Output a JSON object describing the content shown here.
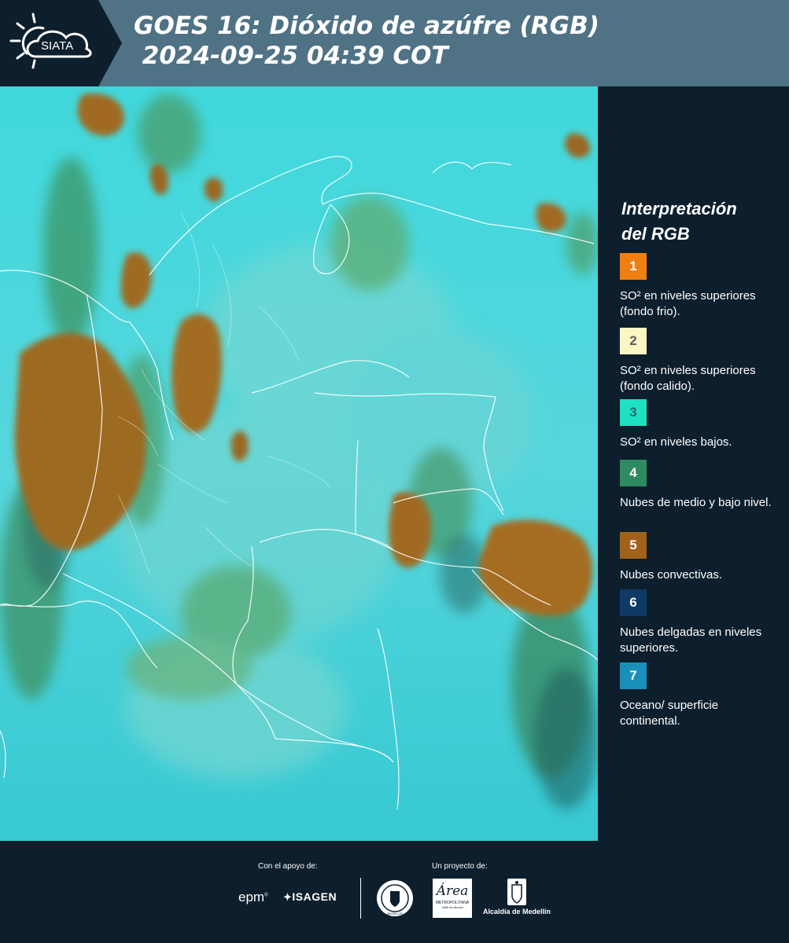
{
  "header": {
    "logo_text": "SIATA",
    "title_line1": "GOES 16: Dióxido de azúfre (RGB)",
    "title_line2": " 2024-09-25 04:39 COT"
  },
  "legend": {
    "title_line1": "Interpretación",
    "title_line2": "del RGB",
    "items": [
      {
        "number": "1",
        "label": "SO² en niveles superiores (fondo frio).",
        "color": "#f07f12",
        "text_color": "#ffffff"
      },
      {
        "number": "2",
        "label": "SO² en niveles superiores (fondo calido).",
        "color": "#fdf5c4",
        "text_color": "#5a5a5a"
      },
      {
        "number": "3",
        "label": "SO² en niveles bajos.",
        "color": "#1fe0c0",
        "text_color": "#2f6a6a"
      },
      {
        "number": "4",
        "label": "Nubes de medio y bajo nivel.",
        "color": "#2f8a5f",
        "text_color": "#ffffff"
      },
      {
        "number": "5",
        "label": "Nubes convectivas.",
        "color": "#a0621a",
        "text_color": "#ffffff"
      },
      {
        "number": "6",
        "label": "Nubes delgadas en niveles superiores.",
        "color": "#0f3a66",
        "text_color": "#ffffff"
      },
      {
        "number": "7",
        "label": "Oceano/ superficie continental.",
        "color": "#1a8fb8",
        "text_color": "#ffffff"
      }
    ]
  },
  "footer": {
    "support_label": "Con el apoyo de:",
    "project_label": "Un proyecto de:",
    "sponsor_epm": "epm",
    "sponsor_isagen": "ISAGEN",
    "area_name": "Área",
    "area_sub1": "METROPOLITANA",
    "area_sub2": "Valle de Aburrá",
    "alcaldia": "Alcaldía de Medellín",
    "medellin_seal": "MEDELLÍN"
  }
}
